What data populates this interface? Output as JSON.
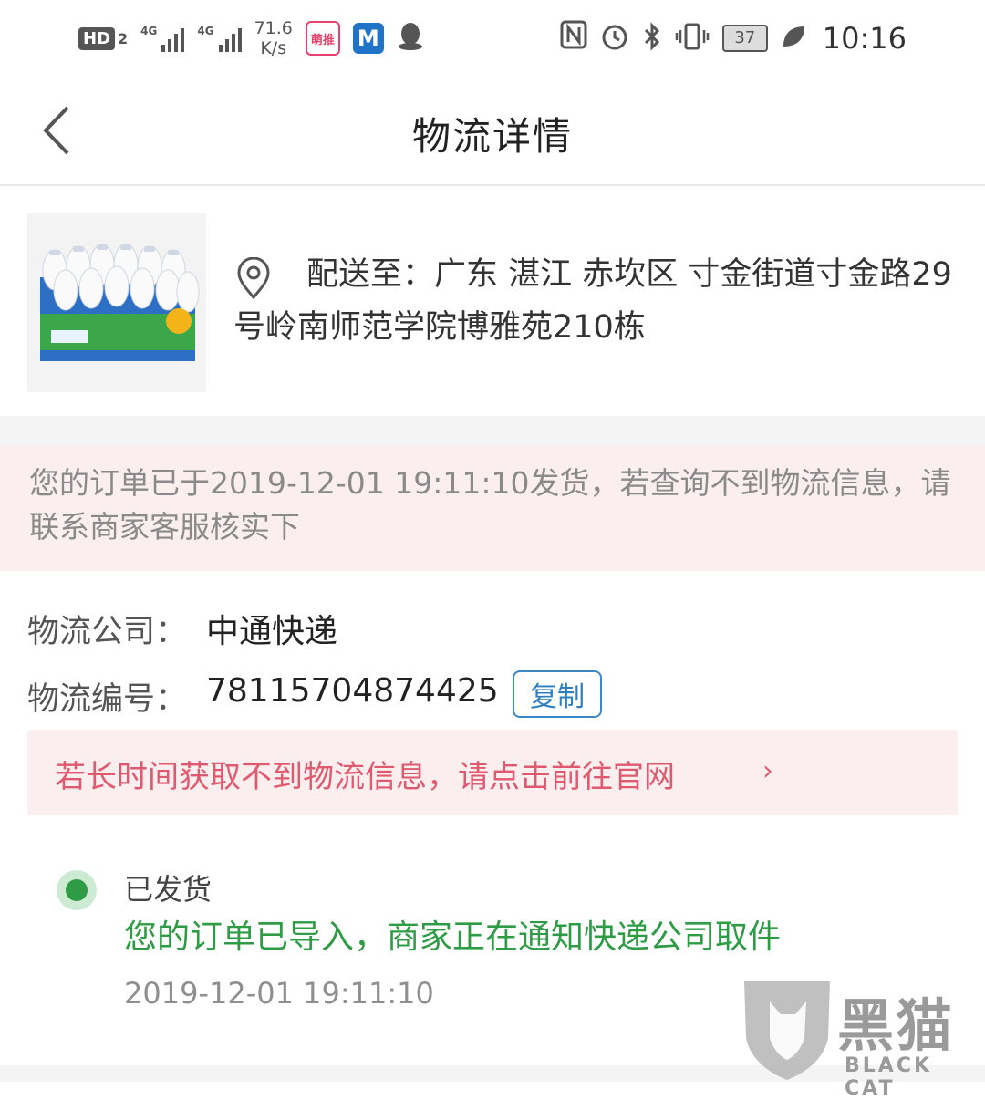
{
  "status_bar": {
    "hd_label": "HD",
    "sim2": "2",
    "net1": "4G",
    "net2": "4G",
    "speed_value": "71.6",
    "speed_unit": "K/s",
    "app_icon_1": "萌推",
    "app_icon_2": "M",
    "battery": "37",
    "time": "10:16"
  },
  "header": {
    "title": "物流详情"
  },
  "order": {
    "address": "配送至：广东 湛江 赤坎区 寸金街道寸金路29号岭南师范学院博雅苑210栋"
  },
  "notice": {
    "text": "您的订单已于2019-12-01 19:11:10发货，若查询不到物流信息，请联系商家客服核实下"
  },
  "logistics": {
    "company_label": "物流公司：",
    "company": "中通快递",
    "number_label": "物流编号：",
    "number": "78115704874425",
    "copy_label": "复制",
    "link_text": "若长时间获取不到物流信息，请点击前往官网",
    "link_chevron": "›"
  },
  "timeline": [
    {
      "title": "已发货",
      "message": "您的订单已导入，商家正在通知快递公司取件",
      "time": "2019-12-01 19:11:10"
    }
  ],
  "watermark": {
    "text": "黑猫",
    "sub": "BLACK CAT"
  },
  "colors": {
    "accent_green": "#2e9b45",
    "link_pink": "#e05a6f",
    "copy_blue": "#3b88c6",
    "notice_bg": "#fbeeee"
  }
}
